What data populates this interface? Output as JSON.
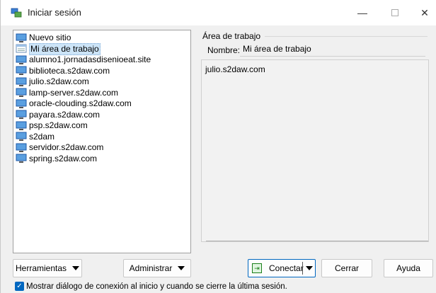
{
  "window": {
    "title": "Iniciar sesión",
    "controls": {
      "minimize": "—",
      "close": "✕"
    }
  },
  "tree": {
    "items": [
      {
        "label": "Nuevo sitio",
        "selected": false
      },
      {
        "label": "Mi área de trabajo",
        "selected": true
      },
      {
        "label": "alumno1.jornadasdisenioeat.site",
        "selected": false
      },
      {
        "label": "biblioteca.s2daw.com",
        "selected": false
      },
      {
        "label": "julio.s2daw.com",
        "selected": false
      },
      {
        "label": "lamp-server.s2daw.com",
        "selected": false
      },
      {
        "label": "oracle-clouding.s2daw.com",
        "selected": false
      },
      {
        "label": "payara.s2daw.com",
        "selected": false
      },
      {
        "label": "psp.s2daw.com",
        "selected": false
      },
      {
        "label": "s2dam",
        "selected": false
      },
      {
        "label": "servidor.s2daw.com",
        "selected": false
      },
      {
        "label": "spring.s2daw.com",
        "selected": false
      }
    ]
  },
  "panel": {
    "group_title": "Área de trabajo",
    "name_label": "Nombre:",
    "name_value": "Mi área de trabajo",
    "summary_line": "julio.s2daw.com"
  },
  "buttons": {
    "tools": "Herramientas",
    "admin": "Administrar",
    "connect": "Conectar",
    "close": "Cerrar",
    "help": "Ayuda"
  },
  "footer": {
    "checkbox_label": "Mostrar diálogo de conexión al inicio y cuando se cierre la última sesión.",
    "checked": true
  },
  "colors": {
    "accent": "#0067c0",
    "selection": "#cce4f7",
    "background": "#f0f0f0"
  }
}
